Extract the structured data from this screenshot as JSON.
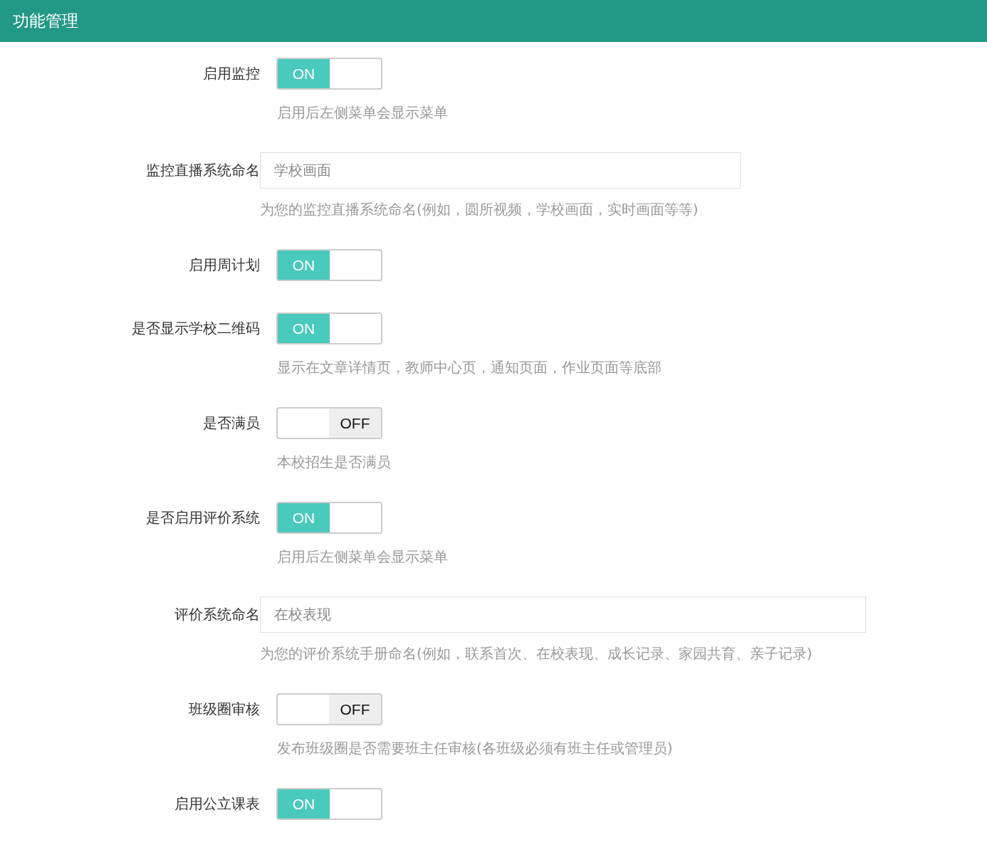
{
  "header": {
    "title": "功能管理"
  },
  "items": [
    {
      "kind": "toggle",
      "label": "启用监控",
      "on": true,
      "state_label": "ON",
      "help": "启用后左侧菜单会显示菜单"
    },
    {
      "kind": "input",
      "label": "监控直播系统命名",
      "value": "学校画面",
      "help": "为您的监控直播系统命名(例如，圆所视频，学校画面，实时画面等等)"
    },
    {
      "kind": "toggle",
      "label": "启用周计划",
      "on": true,
      "state_label": "ON"
    },
    {
      "kind": "toggle",
      "label": "是否显示学校二维码",
      "on": true,
      "state_label": "ON",
      "help": "显示在文章详情页，教师中心页，通知页面，作业页面等底部"
    },
    {
      "kind": "toggle",
      "label": "是否满员",
      "on": false,
      "state_label": "OFF",
      "help": "本校招生是否满员"
    },
    {
      "kind": "toggle",
      "label": "是否启用评价系统",
      "on": true,
      "state_label": "ON",
      "help": "启用后左侧菜单会显示菜单"
    },
    {
      "kind": "input",
      "label": "评价系统命名",
      "value": "在校表现",
      "help": "为您的评价系统手册命名(例如，联系首次、在校表现、成长记录、家园共育、亲子记录)"
    },
    {
      "kind": "toggle",
      "label": "班级圈审核",
      "on": false,
      "state_label": "OFF",
      "help": "发布班级圈是否需要班主任审核(各班级必须有班主任或管理员)"
    },
    {
      "kind": "toggle",
      "label": "启用公立课表",
      "on": true,
      "state_label": "ON"
    }
  ]
}
